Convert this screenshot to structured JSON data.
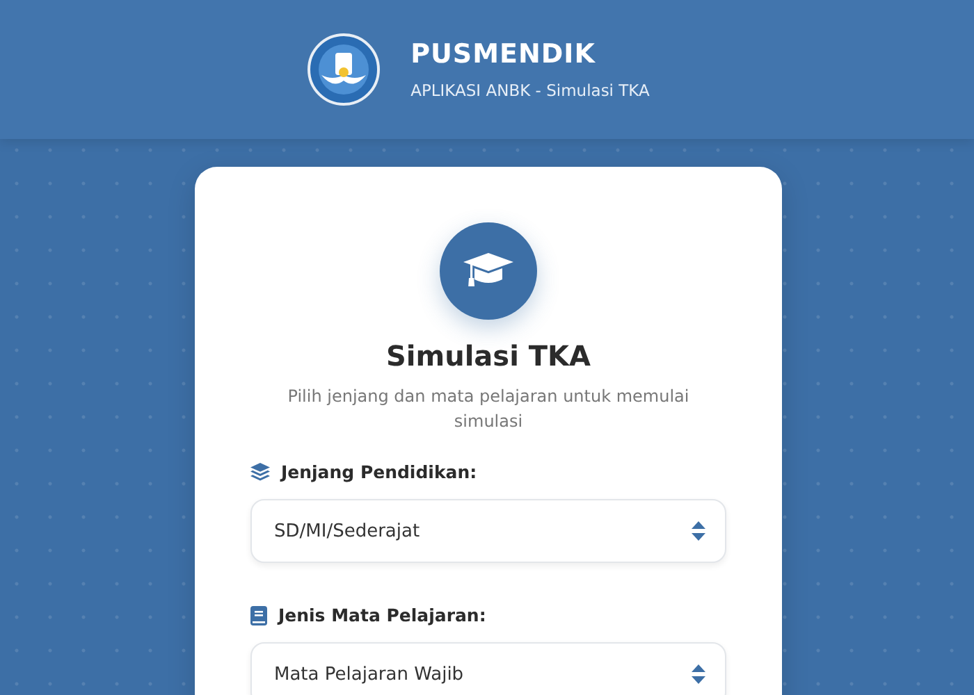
{
  "header": {
    "title": "PUSMENDIK",
    "subtitle": "APLIKASI ANBK - Simulasi TKA"
  },
  "card": {
    "title": "Simulasi TKA",
    "description": "Pilih jenjang dan mata pelajaran untuk memulai simulasi"
  },
  "fields": [
    {
      "kind": "level",
      "label": "Jenjang Pendidikan:",
      "value": "SD/MI/Sederajat"
    },
    {
      "kind": "subject",
      "label": "Jenis Mata Pelajaran:",
      "value": "Mata Pelajaran Wajib"
    }
  ]
}
